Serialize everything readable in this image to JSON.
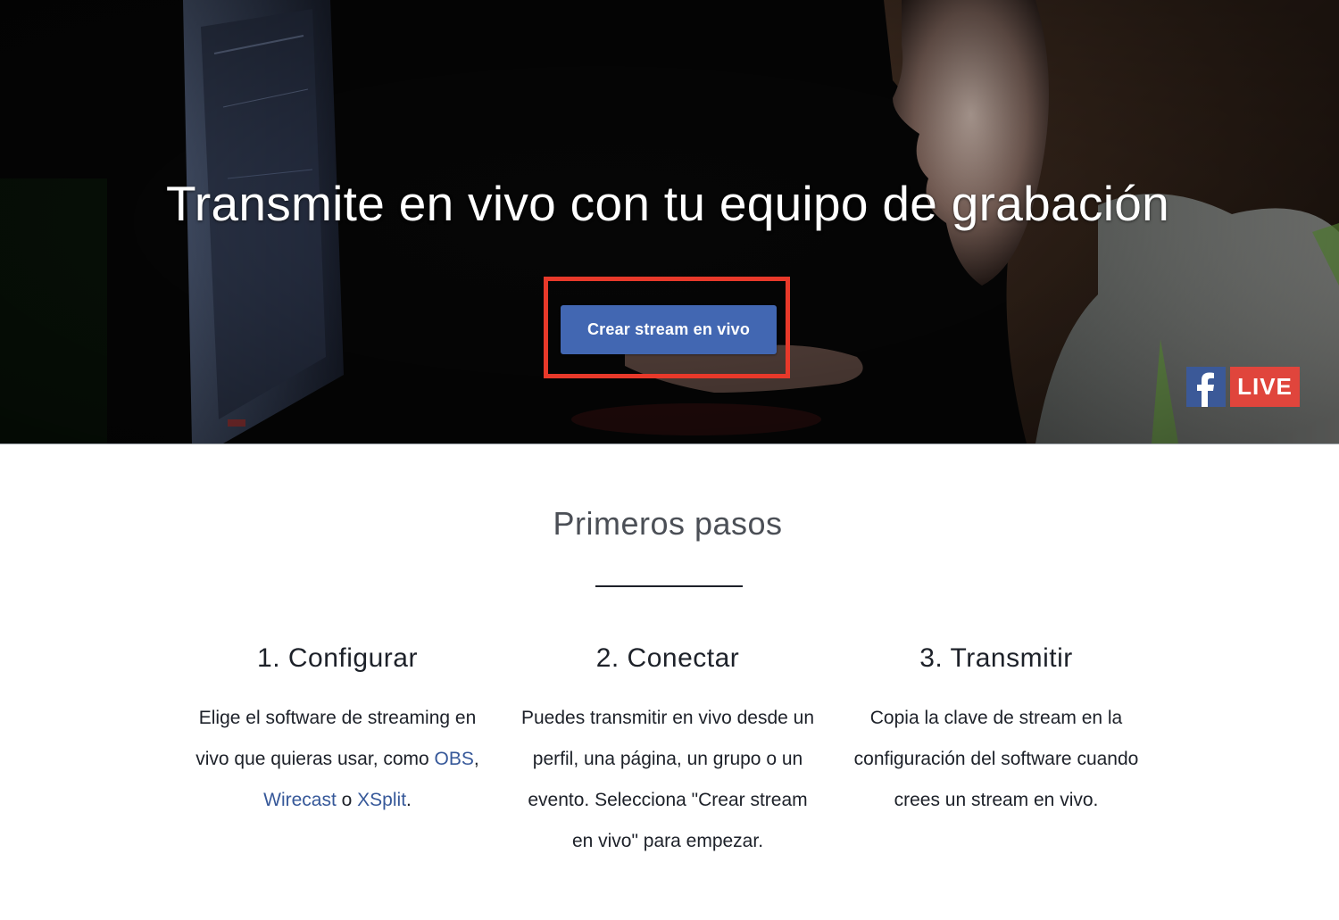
{
  "hero": {
    "title": "Transmite en vivo con tu equipo de grabación",
    "cta_label": "Crear stream en vivo",
    "badge": {
      "icon": "facebook-f-icon",
      "live_label": "LIVE"
    }
  },
  "colors": {
    "cta_background": "#4267b2",
    "highlight_border": "#e8392a",
    "link": "#365899",
    "live_badge": "#e0453c",
    "facebook_blue": "#3b5998"
  },
  "getting_started": {
    "title": "Primeros pasos",
    "steps": [
      {
        "title": "1. Configurar",
        "text_before": "Elige el software de streaming en vivo que quieras usar, como ",
        "links": [
          "OBS",
          "Wirecast",
          "XSplit"
        ],
        "sep1": ", ",
        "sep2": " o ",
        "text_after": "."
      },
      {
        "title": "2. Conectar",
        "text": "Puedes transmitir en vivo desde un perfil, una página, un grupo o un evento. Selecciona \"Crear stream en vivo\" para empezar."
      },
      {
        "title": "3. Transmitir",
        "text": "Copia la clave de stream en la configuración del software cuando crees un stream en vivo."
      }
    ]
  }
}
